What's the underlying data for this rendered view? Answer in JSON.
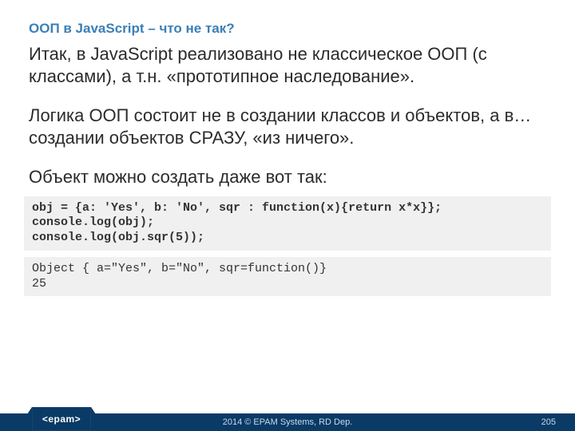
{
  "title": "ООП в JavaScript – что не так?",
  "paragraphs": {
    "p1": "Итак, в JavaScript реализовано не классическое ООП (с классами), а т.н. «прототипное наследование».",
    "p2": "Логика ООП состоит не в создании классов и объектов, а в… создании объектов СРАЗУ, «из ничего».",
    "p3": "Объект можно создать даже вот так:"
  },
  "code": "obj = {a: 'Yes', b: 'No', sqr : function(x){return x*x}};\nconsole.log(obj);\nconsole.log(obj.sqr(5));",
  "output": "Object { a=\"Yes\", b=\"No\", sqr=function()}\n25",
  "footer": {
    "logo": "<epam>",
    "copyright": "2014 © EPAM Systems, RD Dep.",
    "page": "205"
  }
}
